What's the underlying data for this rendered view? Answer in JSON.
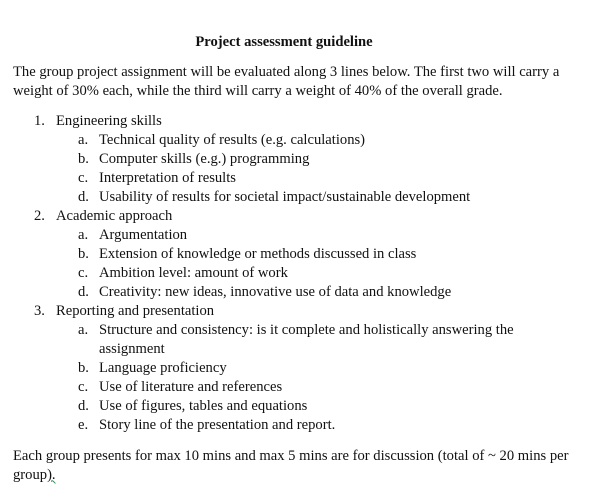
{
  "title": "Project assessment guideline",
  "intro": "The group project assignment will be evaluated along 3 lines below. The first two will carry a weight of 30% each, while the third will carry a weight of 40% of the overall grade.",
  "sections": [
    {
      "number": "1.",
      "label": "Engineering skills",
      "items": [
        {
          "letter": "a.",
          "text": "Technical quality of results (e.g. calculations)"
        },
        {
          "letter": "b.",
          "text": "Computer skills (e.g.) programming"
        },
        {
          "letter": "c.",
          "text": "Interpretation of results"
        },
        {
          "letter": "d.",
          "text": "Usability of results for societal impact/sustainable development"
        }
      ]
    },
    {
      "number": "2.",
      "label": "Academic approach",
      "items": [
        {
          "letter": "a.",
          "text": "Argumentation"
        },
        {
          "letter": "b.",
          "text": "Extension of knowledge or methods discussed in class"
        },
        {
          "letter": "c.",
          "text": "Ambition level: amount of work"
        },
        {
          "letter": "d.",
          "text": "Creativity: new ideas, innovative use of data and knowledge"
        }
      ]
    },
    {
      "number": "3.",
      "label": "Reporting and presentation",
      "items": [
        {
          "letter": "a.",
          "text": "Structure and consistency: is it complete and holistically answering the assignment"
        },
        {
          "letter": "b.",
          "text": "Language proficiency"
        },
        {
          "letter": "c.",
          "text": "Use of literature and references"
        },
        {
          "letter": "d.",
          "text": "Use of figures, tables and equations"
        },
        {
          "letter": "e.",
          "text": "Story line of the presentation and report."
        }
      ]
    }
  ],
  "closing": {
    "main": "Each group presents for max 10 mins and max 5 mins are for discussion (total of ~ 20 mins per group",
    "marked": ").",
    "trailing": " "
  }
}
